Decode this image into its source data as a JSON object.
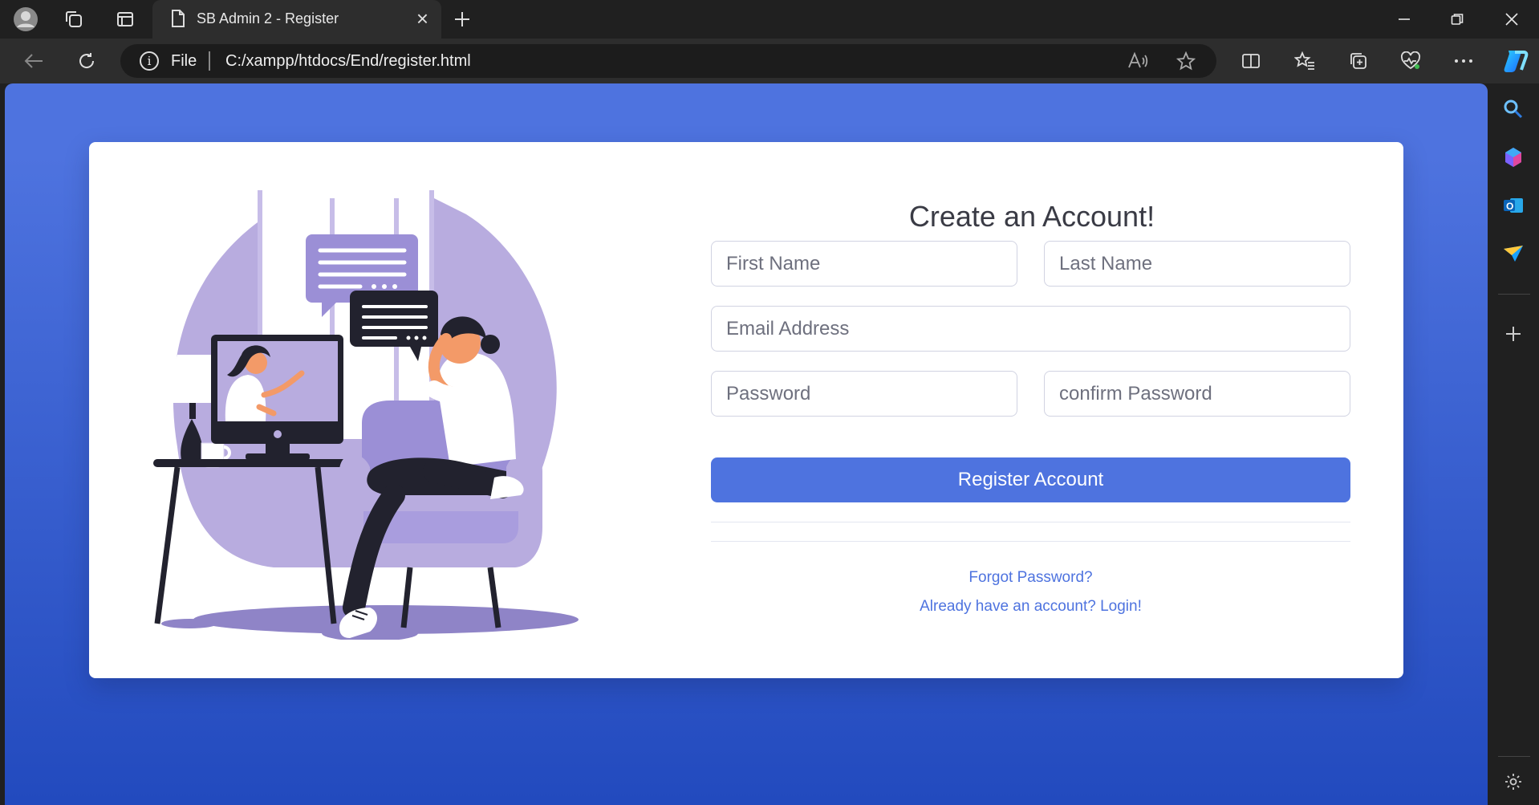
{
  "browser": {
    "tab_title": "SB Admin 2 - Register",
    "address_scheme": "File",
    "address_url": "C:/xampp/htdocs/End/register.html"
  },
  "register": {
    "heading": "Create an Account!",
    "first_name_placeholder": "First Name",
    "last_name_placeholder": "Last Name",
    "email_placeholder": "Email Address",
    "password_placeholder": "Password",
    "confirm_password_placeholder": "confirm Password",
    "submit_label": "Register Account",
    "forgot_password_link": "Forgot Password?",
    "login_link": "Already have an account? Login!"
  },
  "colors": {
    "primary": "#4e73df",
    "gradient_end": "#224abe",
    "illustration_purple": "#b8acdf",
    "illustration_dark": "#1f1f2b"
  }
}
